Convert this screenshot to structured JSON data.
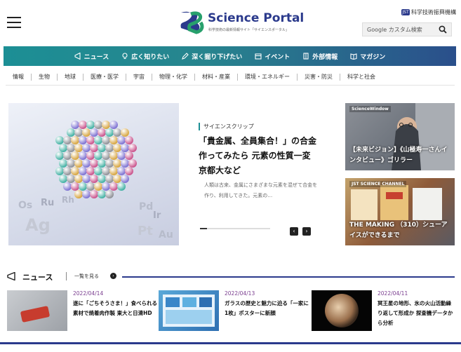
{
  "header": {
    "logo_title": "Science Portal",
    "logo_subtitle": "科学技術の最新情報サイト「サイエンスポータル」",
    "agency_badge": "JST",
    "agency_name": "科学技術振興機構",
    "search_placeholder": "Google カスタム検索"
  },
  "main_nav": [
    {
      "label": "ニュース",
      "icon": "megaphone-icon"
    },
    {
      "label": "広く知りたい",
      "icon": "lightbulb-icon"
    },
    {
      "label": "深く掘り下げたい",
      "icon": "pencil-icon"
    },
    {
      "label": "イベント",
      "icon": "calendar-icon"
    },
    {
      "label": "外部情報",
      "icon": "building-icon"
    },
    {
      "label": "マガジン",
      "icon": "book-icon"
    }
  ],
  "sub_nav": [
    "情報",
    "生物",
    "地球",
    "医療・医学",
    "宇宙",
    "物理・化学",
    "材料・産業",
    "環境・エネルギー",
    "災害・防災",
    "科学と社会"
  ],
  "hero": {
    "tag": "サイエンスクリップ",
    "title": "「貴金属、全員集合！」の合金作ってみたら 元素の性質一変 京都大など",
    "excerpt": "人類は古来、金属にさまざまな元素を混ぜて合金を作り、利用してきた。元素の…",
    "image_labels": [
      "Os",
      "Ru",
      "Rh",
      "Ag",
      "Pd",
      "Ir",
      "Pt",
      "Au"
    ],
    "slider_progress": 0.1,
    "prev_label": "‹",
    "next_label": "›"
  },
  "side_cards": [
    {
      "brand": "ScienceWindow",
      "caption": "【未来ビジョン】《山極寿一さんインタビュー》ゴリラー"
    },
    {
      "brand": "JST SCIENCE CHANNEL",
      "caption": "THE MAKING （310）シューアイスができるまで"
    }
  ],
  "news": {
    "title": "ニュース",
    "more_label": "一覧を見る",
    "more_icon": "›",
    "items": [
      {
        "date": "2022/04/14",
        "text": "遂に「ごちそうさま！」食べられる素材で焼着肉作製 東大と日清HD"
      },
      {
        "date": "2022/04/13",
        "text": "ガラスの歴史と魅力に迫る「一家に1枚」ポスターに新顔"
      },
      {
        "date": "2022/04/11",
        "text": "冥王星の地形、氷の火山活動繰り返して形成か 探査機データから分析"
      }
    ]
  },
  "colors": {
    "nav_start": "#1c8f95",
    "nav_end": "#2a4f8b",
    "brand_navy": "#2b3a8c",
    "date_purple": "#7a3d8f"
  }
}
